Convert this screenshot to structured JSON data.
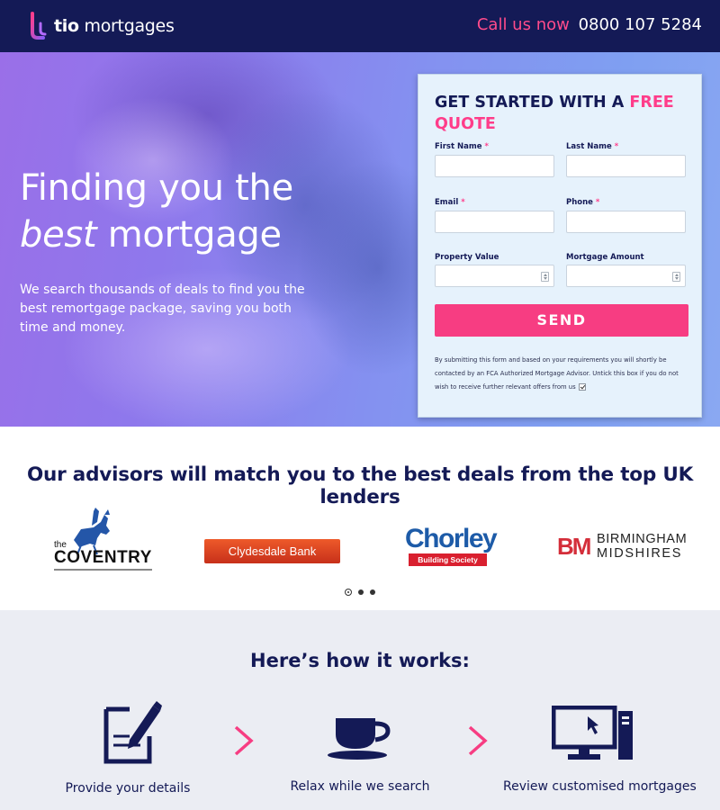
{
  "header": {
    "logo_text_bold": "tio",
    "logo_text": "mortgages",
    "call_label": "Call us now",
    "phone": "0800 107 5284",
    "accent_color": "#ff4b8b",
    "background_color": "#141a56"
  },
  "hero": {
    "title_line1": "Finding you the",
    "title_em": "best",
    "title_line2_rest": "mortgage",
    "subtitle": "We search thousands of deals to find you the best remortgage package, saving you both time and money."
  },
  "form": {
    "title_prefix": "GET STARTED WITH A",
    "title_highlight": "FREE QUOTE",
    "fields": {
      "first_name": {
        "label": "First Name",
        "required": "*",
        "value": ""
      },
      "last_name": {
        "label": "Last Name",
        "required": "*",
        "value": ""
      },
      "email": {
        "label": "Email",
        "required": "*",
        "value": ""
      },
      "phone": {
        "label": "Phone",
        "required": "*",
        "value": ""
      },
      "property_value": {
        "label": "Property Value",
        "value": ""
      },
      "mortgage_amount": {
        "label": "Mortgage Amount",
        "value": ""
      }
    },
    "send_label": "SEND",
    "consent_text": "By submitting this form and based on your requirements you will shortly be contacted by an FCA Authorized Mortgage Advisor. Untick this box if you do not wish to receive further relevant offers from us",
    "consent_checked": true,
    "button_color": "#f73d82"
  },
  "lenders": {
    "title": "Our advisors will match you to the best deals from the top UK lenders",
    "items": [
      {
        "name": "the COVENTRY",
        "line1": "the",
        "line2": "COVENTRY"
      },
      {
        "name": "Clydesdale Bank",
        "text": "Clydesdale Bank"
      },
      {
        "name": "Chorley Building Society",
        "line1": "Chorley",
        "line2": "Building Society"
      },
      {
        "name": "Birmingham Midshires",
        "mark": "BM",
        "line1": "BIRMINGHAM",
        "line2": "MIDSHIRES"
      }
    ],
    "carousel": {
      "pages": 3,
      "active_page": 1
    }
  },
  "how_it_works": {
    "title": "Here’s how it works:",
    "steps": [
      {
        "label": "Provide your details",
        "icon": "form-pencil-icon"
      },
      {
        "label": "Relax while we search",
        "icon": "coffee-cup-icon"
      },
      {
        "label": "Review customised mortgages",
        "icon": "computer-monitor-icon"
      }
    ]
  }
}
